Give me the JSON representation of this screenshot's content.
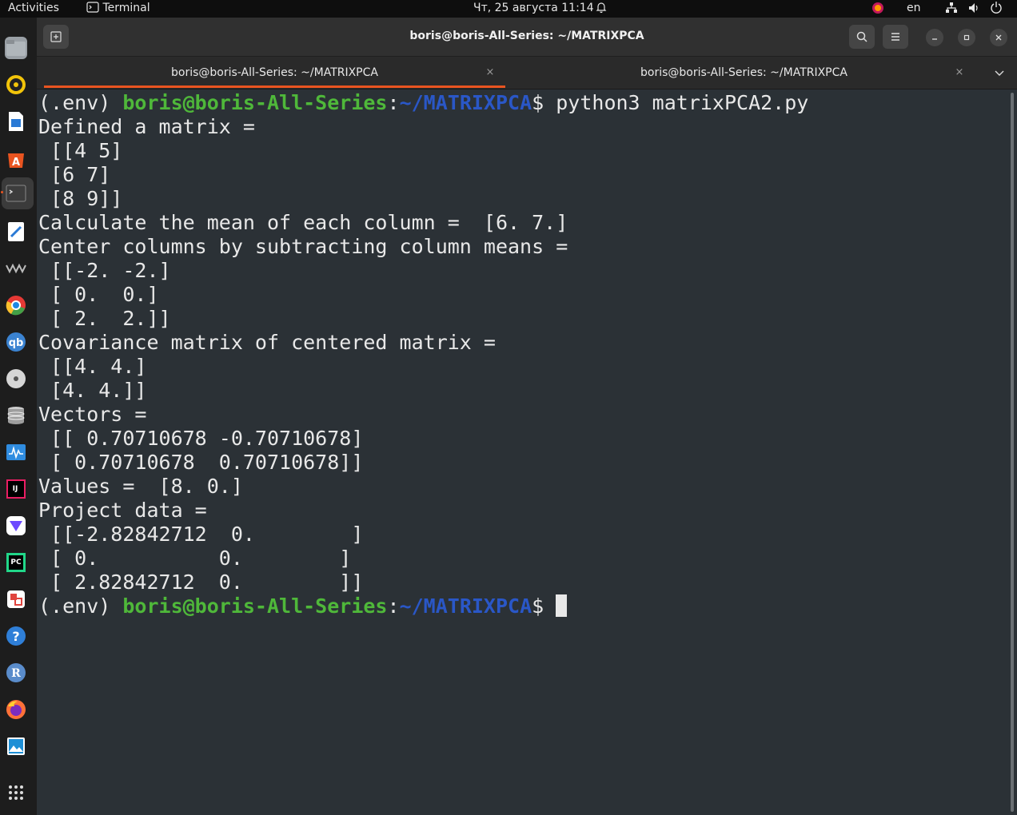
{
  "topbar": {
    "activities": "Activities",
    "app_name": "Terminal",
    "datetime": "Чт, 25 августа  11:14",
    "language": "en"
  },
  "dock": {
    "apps": [
      {
        "name": "files-icon",
        "color": "#8a8f94"
      },
      {
        "name": "rhythmbox-icon",
        "color": "#f2c40a"
      },
      {
        "name": "libreoffice-writer-icon",
        "color": "#2a7ad5"
      },
      {
        "name": "ubuntu-software-icon",
        "color": "#e95420"
      },
      {
        "name": "terminal-icon",
        "color": "#3b3b3b"
      },
      {
        "name": "text-editor-icon",
        "color": "#ffffff"
      },
      {
        "name": "wireshark-like-icon",
        "color": "#555555"
      },
      {
        "name": "chrome-icon",
        "color": "#e53935"
      },
      {
        "name": "qbittorrent-icon",
        "color": "#3b83d1"
      },
      {
        "name": "disc-icon",
        "color": "#c9c9c9"
      },
      {
        "name": "database-icon",
        "color": "#9e9e9e"
      },
      {
        "name": "system-monitor-icon",
        "color": "#2f8ce0"
      },
      {
        "name": "intellij-icon",
        "color": "#000000"
      },
      {
        "name": "proton-vpn-icon",
        "color": "#6d4aff"
      },
      {
        "name": "pycharm-icon",
        "color": "#21d789"
      },
      {
        "name": "screenshot-tool-icon",
        "color": "#e0443e"
      },
      {
        "name": "help-icon",
        "color": "#2f7fd8"
      },
      {
        "name": "r-studio-icon",
        "color": "#5a8ccb"
      },
      {
        "name": "firefox-icon",
        "color": "#ff7139"
      },
      {
        "name": "image-viewer-icon",
        "color": "#1d8fd6"
      }
    ]
  },
  "window": {
    "title": "boris@boris-All-Series: ~/MATRIXPCA",
    "tabs": [
      {
        "label": "boris@boris-All-Series: ~/MATRIXPCA",
        "active": true
      },
      {
        "label": "boris@boris-All-Series: ~/MATRIXPCA",
        "active": false
      }
    ],
    "tab_close_glyph": "×"
  },
  "terminal": {
    "prompt_env": "(.env) ",
    "prompt_user": "boris@boris-All-Series",
    "prompt_colon": ":",
    "prompt_path": "~/MATRIXPCA",
    "prompt_dollar": "$ ",
    "command": "python3 matrixPCA2.py",
    "output": [
      "Defined a matrix =",
      " [[4 5]",
      " [6 7]",
      " [8 9]]",
      "Calculate the mean of each column =  [6. 7.]",
      "Center columns by subtracting column means =",
      " [[-2. -2.]",
      " [ 0.  0.]",
      " [ 2.  2.]]",
      "Covariance matrix of centered matrix =",
      " [[4. 4.]",
      " [4. 4.]]",
      "Vectors =",
      " [[ 0.70710678 -0.70710678]",
      " [ 0.70710678  0.70710678]]",
      "Values =  [8. 0.]",
      "Project data =",
      " [[-2.82842712  0.        ]",
      " [ 0.          0.        ]",
      " [ 2.82842712  0.        ]]"
    ]
  }
}
